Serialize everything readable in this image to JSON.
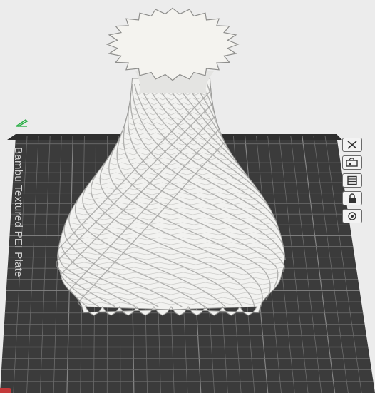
{
  "plate": {
    "label": "Bambu Textured PEI Plate"
  },
  "colors": {
    "background": "#ececec",
    "plate": "#3b3b3b",
    "grid_line": "#6c6c6c",
    "grid_line_major": "#858585",
    "model": "#f2f2f0",
    "model_shadow": "#9a9a98",
    "accent_green": "#2fb14a",
    "accent_red": "#c23a3a"
  },
  "toolbar": {
    "buttons": [
      {
        "name": "close-plate-button",
        "icon": "x-icon"
      },
      {
        "name": "arrange-plate-button",
        "icon": "arrange-icon"
      },
      {
        "name": "plate-settings-button",
        "icon": "layers-icon"
      },
      {
        "name": "lock-plate-button",
        "icon": "lock-icon"
      },
      {
        "name": "auto-orient-button",
        "icon": "target-icon"
      }
    ]
  },
  "model": {
    "name": "twisted-vase",
    "ribs": 24
  }
}
